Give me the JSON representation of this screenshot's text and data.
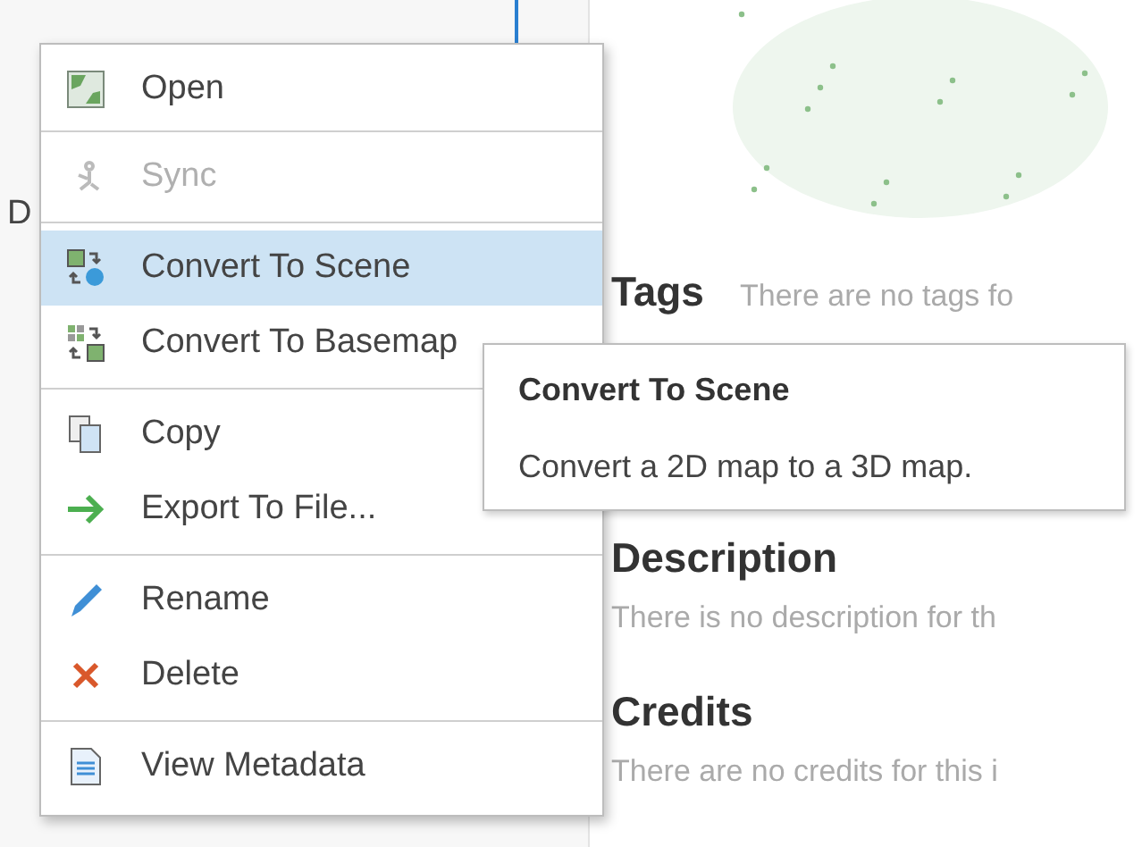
{
  "background_panel": {
    "text": "D"
  },
  "details": {
    "tags": {
      "heading": "Tags",
      "text": "There are no tags fo"
    },
    "sections": [
      {
        "heading": "Description",
        "text": "There is no description for th"
      },
      {
        "heading": "Credits",
        "text": "There are no credits for this i"
      }
    ]
  },
  "context_menu": {
    "groups": [
      [
        {
          "label": "Open",
          "disabled": false,
          "selected": false
        }
      ],
      [
        {
          "label": "Sync",
          "disabled": true,
          "selected": false
        }
      ],
      [
        {
          "label": "Convert To Scene",
          "disabled": false,
          "selected": true
        },
        {
          "label": "Convert To Basemap",
          "disabled": false,
          "selected": false
        }
      ],
      [
        {
          "label": "Copy",
          "disabled": false,
          "selected": false
        },
        {
          "label": "Export To File...",
          "disabled": false,
          "selected": false
        }
      ],
      [
        {
          "label": "Rename",
          "disabled": false,
          "selected": false
        },
        {
          "label": "Delete",
          "disabled": false,
          "selected": false
        }
      ],
      [
        {
          "label": "View Metadata",
          "disabled": false,
          "selected": false
        }
      ]
    ]
  },
  "tooltip": {
    "title": "Convert To Scene",
    "text": "Convert a 2D map to a 3D map."
  }
}
